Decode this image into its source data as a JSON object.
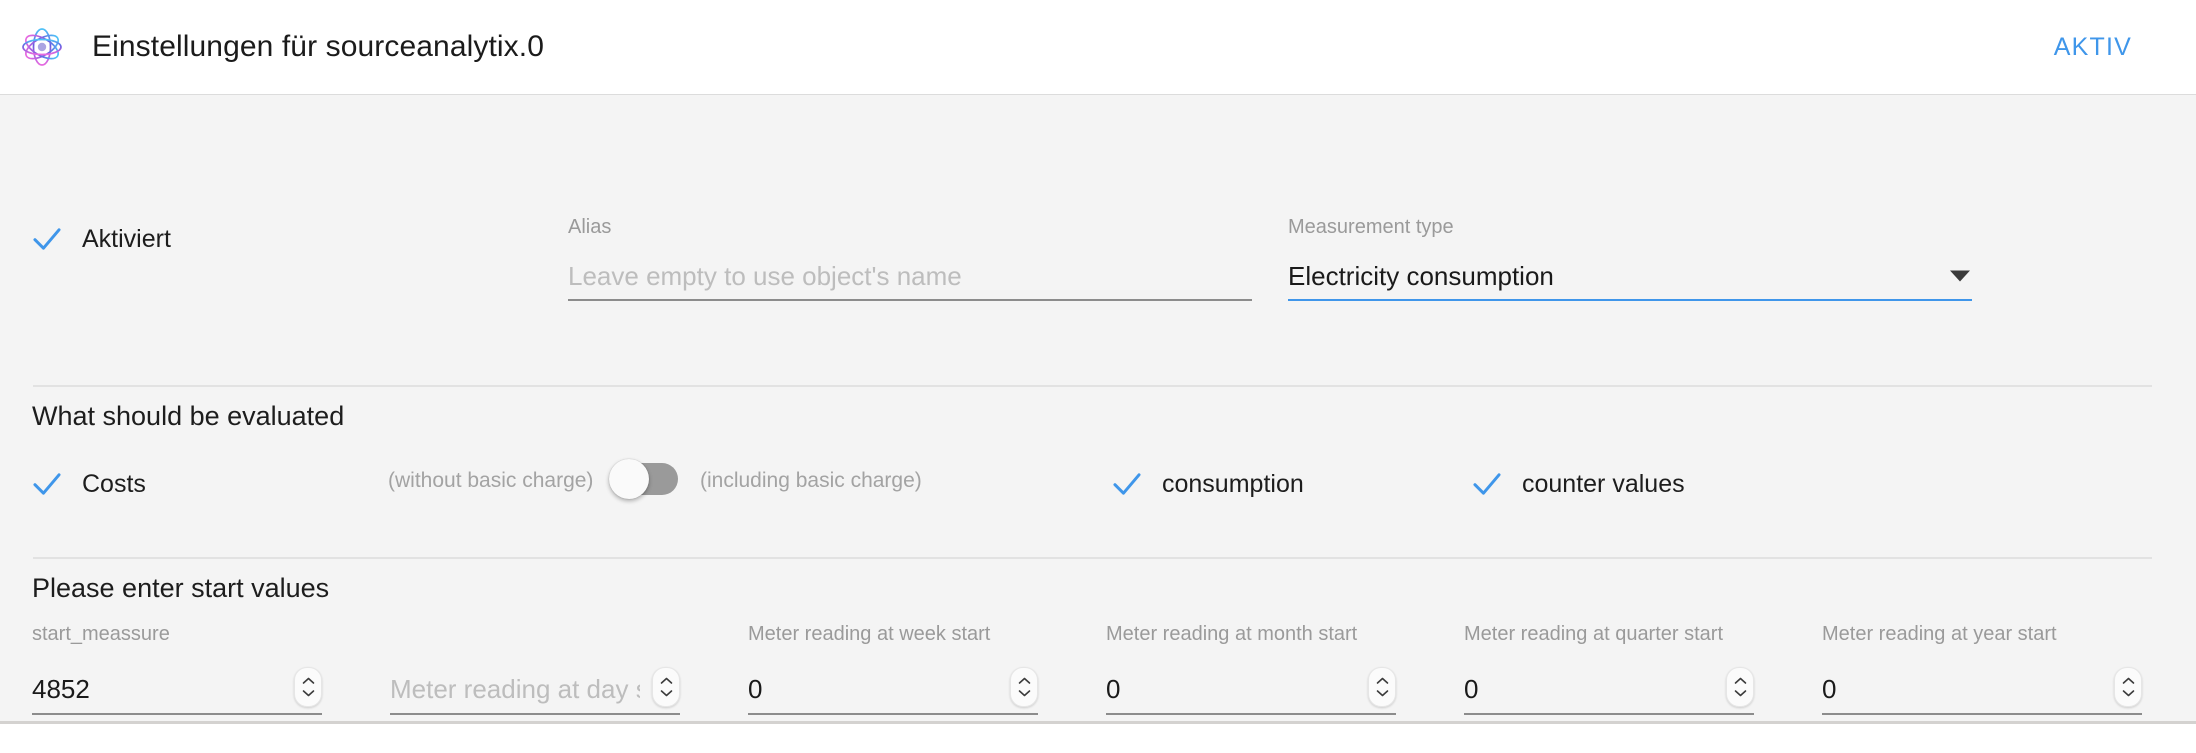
{
  "header": {
    "logo_icon": "atom-icon",
    "title": "Einstellungen für sourceanalytix.0",
    "status": "AKTIV"
  },
  "top_row": {
    "enabled": {
      "label": "Aktiviert",
      "checked": true,
      "check_color": "#3f96ea"
    },
    "alias": {
      "label": "Alias",
      "value": "",
      "placeholder": "Leave empty to use object's name"
    },
    "measurement_type": {
      "label": "Measurement type",
      "value": "Electricity consumption",
      "focused": true,
      "arrow_icon": "chevron-down-icon",
      "underline_color": "#3f96ea"
    }
  },
  "evaluate_section": {
    "title": "What should be evaluated",
    "costs": {
      "label": "Costs",
      "checked": true
    },
    "basic_charge_left": "(without basic charge)",
    "basic_charge_right": "(including basic charge)",
    "basic_charge_toggle": {
      "state": "off"
    },
    "consumption": {
      "label": "consumption",
      "checked": true
    },
    "counter_values": {
      "label": "counter values",
      "checked": true
    }
  },
  "start_values_section": {
    "title": "Please enter start values",
    "fields": [
      {
        "label": "start_meassure",
        "value": "4852",
        "placeholder": "",
        "stepper_icon": "spinner-updown-icon"
      },
      {
        "label": "",
        "value": "",
        "placeholder": "Meter reading at day start",
        "stepper_icon": "spinner-updown-icon"
      },
      {
        "label": "Meter reading at week start",
        "value": "0",
        "placeholder": "",
        "stepper_icon": "spinner-updown-icon"
      },
      {
        "label": "Meter reading at month start",
        "value": "0",
        "placeholder": "",
        "stepper_icon": "spinner-updown-icon"
      },
      {
        "label": "Meter reading at quarter start",
        "value": "0",
        "placeholder": "",
        "stepper_icon": "spinner-updown-icon"
      },
      {
        "label": "Meter reading at year start",
        "value": "0",
        "placeholder": "",
        "stepper_icon": "spinner-updown-icon"
      }
    ]
  }
}
